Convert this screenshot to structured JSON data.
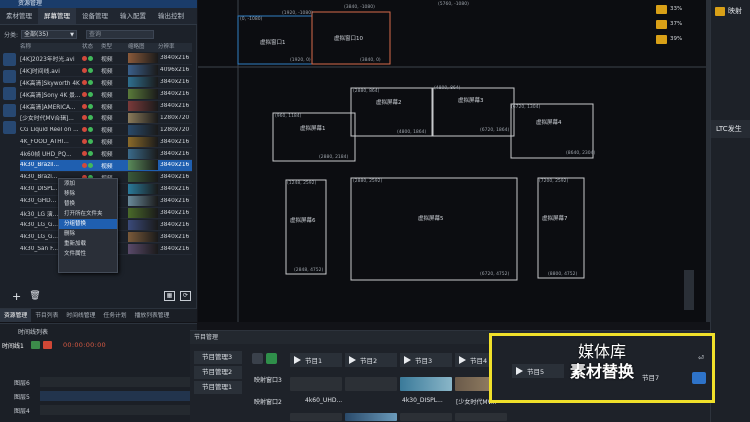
{
  "left_panel": {
    "title": "资源管理",
    "tabs": [
      "素材管理",
      "屏幕管理",
      "设备管理",
      "输入配置",
      "输出控制"
    ],
    "filter": {
      "label": "分类:",
      "selected": "全部(35)",
      "search_label": "查询"
    },
    "columns": [
      "名称",
      "状态",
      "类型",
      "缩略图",
      "分辨率"
    ],
    "rows": [
      {
        "name": "[4K]2023年时光.avi",
        "type": "视频",
        "res": "3840x216",
        "c": "#8a5a3a"
      },
      {
        "name": "[4K]时间线.avi",
        "type": "视频",
        "res": "4096x216",
        "c": "#3b5f8a"
      },
      {
        "name": "[4K高清]Skyworth 4K 效...",
        "type": "视频",
        "res": "3840x216",
        "c": "#2f6f8f"
      },
      {
        "name": "[4K高清]Sony 4K 景...",
        "type": "视频",
        "res": "3840x216",
        "c": "#5a7a3a"
      },
      {
        "name": "[4K高清]AMERICA...",
        "type": "视频",
        "res": "3840x216",
        "c": "#7a3a3a"
      },
      {
        "name": "[少女时代MV合辑]...",
        "type": "视频",
        "res": "1280x720",
        "c": "#8a7a5a"
      },
      {
        "name": "CG Liquid Reel on ...",
        "type": "视频",
        "res": "1280x720",
        "c": "#2a4a6a"
      },
      {
        "name": "4K_FOOD_ATHI...",
        "type": "视频",
        "res": "3840x216",
        "c": "#8a6a2a"
      },
      {
        "name": "4k60帧 UHD_PQ...",
        "type": "视频",
        "res": "3840x216",
        "c": "#3a6a8a"
      },
      {
        "name": "4k30_Brazil...",
        "type": "视频",
        "res": "3840x216",
        "c": "#5a8a5a"
      },
      {
        "name": "4k30_Brazi...",
        "type": "视频",
        "res": "3840x216",
        "c": "#3a5a3a"
      },
      {
        "name": "4k30_DISPL...",
        "type": "视频",
        "res": "3840x216",
        "c": "#2a7a9a"
      },
      {
        "name": "4k30_GHD...",
        "type": "视频",
        "res": "3840x216",
        "c": "#6a8a9a"
      },
      {
        "name": "4k30_LG 演...",
        "type": "视频",
        "res": "3840x216",
        "c": "#4a6a2a"
      },
      {
        "name": "4k30_LG_G...",
        "type": "视频",
        "res": "3840x216",
        "c": "#3a4a7a"
      },
      {
        "name": "4k30_LG_G...",
        "type": "视频",
        "res": "3840x216",
        "c": "#7a5a3a"
      },
      {
        "name": "4k30_San F...",
        "type": "视频",
        "res": "3840x216",
        "c": "#5a4a6a"
      }
    ],
    "context_menu": [
      "添加",
      "移除",
      "替换",
      "打开所在文件夹",
      "分组替换",
      "删除",
      "重新加载",
      "文件属性"
    ],
    "bottom_tabs": [
      "资源管理",
      "节目列表",
      "时间线管理",
      "任务计划",
      "播放列表管理"
    ]
  },
  "canvas": {
    "screens": [
      {
        "label": "虚拟窗口1",
        "tl": "",
        "br": "(1920, 0)"
      },
      {
        "label": "虚拟窗口10",
        "tl": "(3840, -1080)",
        "br": "(3840, 0)"
      },
      {
        "label": "虚拟屏幕1",
        "tl": "(960, 1184)",
        "br": "(2880, 2184)"
      },
      {
        "label": "虚拟屏幕2",
        "tl": "(2880, 864)",
        "br": "(4800, 1864)"
      },
      {
        "label": "虚拟屏幕3",
        "tl": "(4800, 864)",
        "br": "(6720, 1864)"
      },
      {
        "label": "虚拟屏幕4",
        "tl": "(6720, 1304)",
        "br": "(8640, 2304)"
      },
      {
        "label": "虚拟屏幕5",
        "tl": "(2880, 2592)",
        "br": "(6720, 4752)"
      },
      {
        "label": "虚拟屏幕6",
        "tl": "(1248, 2592)",
        "br": "(2848, 4752)"
      },
      {
        "label": "虚拟屏幕7",
        "tl": "(7200, 2592)",
        "br": "(8800, 4752)"
      }
    ],
    "top_coords": [
      "(0, -1080)",
      "(1920, -1080)",
      "(5760, -1080)"
    ]
  },
  "right_strip": [
    {
      "val": "33%"
    },
    {
      "val": "37%"
    },
    {
      "val": "39%"
    }
  ],
  "right_panel": {
    "item": "映射",
    "ltc": "LTC发生"
  },
  "timeline": {
    "title": "时间线列表",
    "track_label": "时间线1",
    "timecode": "00:00:00:00",
    "layers": [
      "图层6",
      "图层5",
      "图层4"
    ]
  },
  "program": {
    "title": "节目管理",
    "groups": [
      "节目管理3",
      "节目管理2",
      "节目管理1"
    ],
    "tabs": [
      "节目1",
      "节目2",
      "节目3",
      "节目4"
    ],
    "windows": [
      "映射窗口3",
      "映射窗口2"
    ],
    "thumb_labels": [
      "4k60_UHD...",
      "4k30_DISPL...",
      "[少女时代MV..."
    ]
  },
  "overlay": {
    "title": "媒体库",
    "subtitle": "素材替换",
    "tab5": "节目5",
    "tab7": "节目7",
    "send": "⏎"
  }
}
